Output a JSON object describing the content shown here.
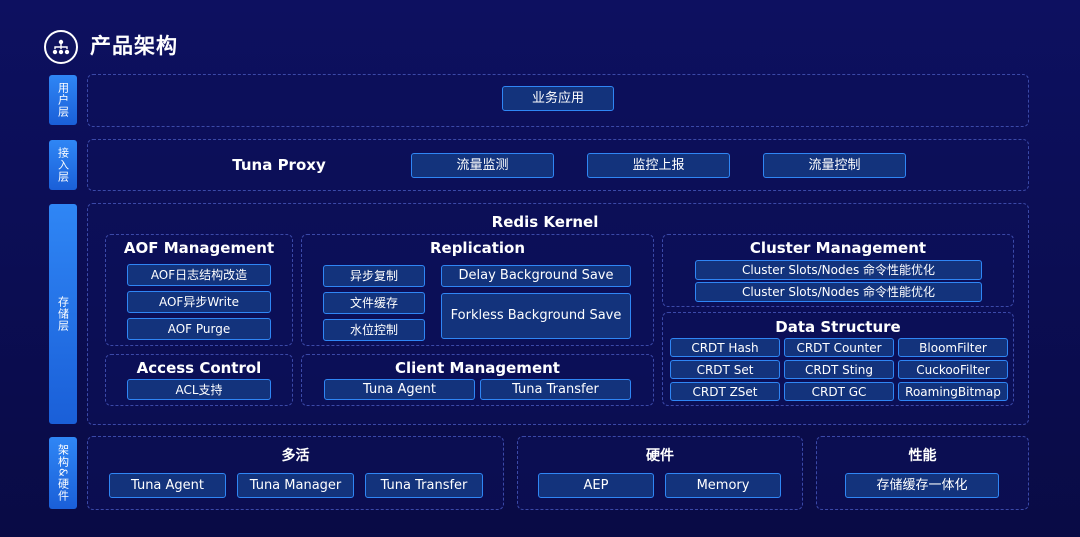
{
  "page_title": "产品架构",
  "icon_name": "architecture-network-icon",
  "colors": {
    "background": "#0b0d52",
    "label_blue": "#2f86f5",
    "chip_fill": "#13337c",
    "dashed_border": "#3b49a8"
  },
  "layers": {
    "user": {
      "label": "用户层"
    },
    "access": {
      "label": "接入层"
    },
    "storage": {
      "label": "存储层"
    },
    "infra": {
      "label": "架构&硬件"
    }
  },
  "user_layer": {
    "app_chip": "业务应用"
  },
  "access_layer": {
    "title": "Tuna Proxy",
    "chips": [
      "流量监测",
      "监控上报",
      "流量控制"
    ]
  },
  "storage_layer": {
    "title": "Redis Kernel",
    "aof": {
      "title": "AOF Management",
      "items": [
        "AOF日志结构改造",
        "AOF异步Write",
        "AOF Purge"
      ]
    },
    "replication": {
      "title": "Replication",
      "left_items": [
        "异步复制",
        "文件缓存",
        "水位控制"
      ],
      "delay_save": "Delay Background Save",
      "forkless_save": "Forkless Background Save"
    },
    "cluster": {
      "title": "Cluster Management",
      "items": [
        "Cluster Slots/Nodes 命令性能优化",
        "Cluster Slots/Nodes 命令性能优化"
      ]
    },
    "data_structure": {
      "title": "Data Structure",
      "items": [
        "CRDT Hash",
        "CRDT Counter",
        "BloomFilter",
        "CRDT Set",
        "CRDT Sting",
        "CuckooFilter",
        "CRDT ZSet",
        "CRDT GC",
        "RoamingBitmap"
      ]
    },
    "access_control": {
      "title": "Access Control",
      "items": [
        "ACL支持"
      ]
    },
    "client": {
      "title": "Client Management",
      "items": [
        "Tuna Agent",
        "Tuna Transfer"
      ]
    }
  },
  "infra_layer": {
    "multi_active": {
      "title": "多活",
      "items": [
        "Tuna Agent",
        "Tuna Manager",
        "Tuna Transfer"
      ]
    },
    "hardware": {
      "title": "硬件",
      "items": [
        "AEP",
        "Memory"
      ]
    },
    "performance": {
      "title": "性能",
      "items": [
        "存储缓存一体化"
      ]
    }
  }
}
